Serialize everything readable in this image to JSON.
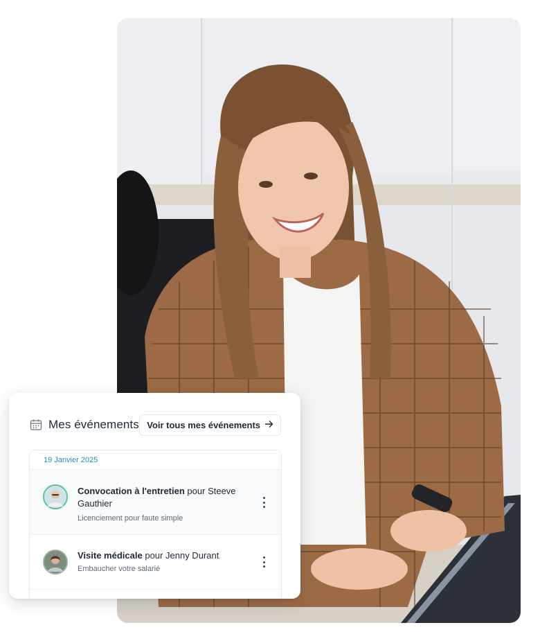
{
  "events_widget": {
    "title": "Mes événements",
    "see_all_label": "Voir tous mes événements",
    "date_group": "19 Janvier 2025",
    "events": [
      {
        "type": "Convocation à l'entretien",
        "connector": "pour",
        "person": "Steeve Gauthier",
        "subtitle": "Licenciement pour faute simple"
      },
      {
        "type": "Visite médicale",
        "connector": "pour",
        "person": "Jenny Durant",
        "subtitle": "Embaucher votre salarié"
      }
    ]
  },
  "icons": {
    "calendar": "calendar-icon",
    "arrow": "arrow-right-icon",
    "more": "more-vertical-icon"
  },
  "colors": {
    "date_accent": "#2a8ab8",
    "avatar_ring_1": "#57c39a",
    "avatar_ring_2": "#8fb29a"
  }
}
